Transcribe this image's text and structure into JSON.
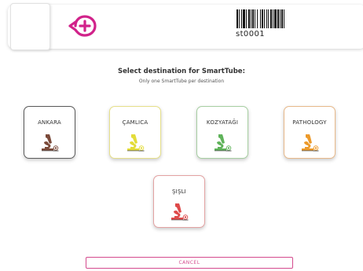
{
  "header": {
    "tube_id": "st0001",
    "logo_icon": "plus-circle-logo-icon",
    "barcode_icon": "barcode-icon",
    "brand_color": "#d1228a"
  },
  "prompt": {
    "title": "Select destination for SmartTube:",
    "subtitle": "Only one SmartTube per destination"
  },
  "destinations": [
    {
      "label": "ANKARA",
      "color": "#7b4a3a",
      "border": "#5b5b5b",
      "icon": "microscope-icon"
    },
    {
      "label": "ÇAMLICA",
      "color": "#e3dc3a",
      "border": "#e6e08a",
      "icon": "microscope-icon"
    },
    {
      "label": "KOZYATAĞI",
      "color": "#5fb35a",
      "border": "#a7cfa2",
      "icon": "microscope-icon"
    },
    {
      "label": "PATHOLOGY",
      "color": "#ec9a2b",
      "border": "#e8b98a",
      "icon": "microscope-icon"
    },
    {
      "label": "ŞIŞLI",
      "color": "#de4a4a",
      "border": "#e3a2a2",
      "icon": "microscope-icon"
    }
  ],
  "actions": {
    "cancel_label": "CANCEL"
  }
}
